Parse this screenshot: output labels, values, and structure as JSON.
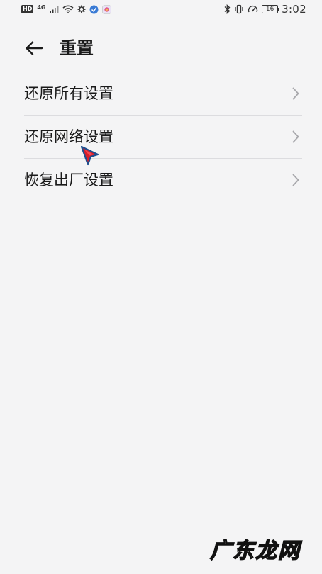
{
  "status_bar": {
    "left_icons": [
      "hd-badge",
      "4g-signal-icon",
      "signal-bars-icon",
      "wifi-icon",
      "settings-gear-icon",
      "app-notification-icon",
      "app-notification-icon-2"
    ],
    "hd_label": "HD",
    "network_label": "4G",
    "right_icons": [
      "bluetooth-icon",
      "vibrate-icon",
      "data-saver-icon",
      "battery-icon"
    ],
    "battery_level": "16",
    "time": "3:02"
  },
  "header": {
    "title": "重置"
  },
  "reset_options": [
    {
      "label": "还原所有设置"
    },
    {
      "label": "还原网络设置"
    },
    {
      "label": "恢复出厂设置"
    }
  ],
  "watermark": "广东龙网",
  "colors": {
    "background": "#f4f4f5",
    "text_primary": "#1a1a1a",
    "chevron": "#a8a8ac",
    "divider": "#dcdcdf",
    "cursor_red": "#d81e2a",
    "cursor_blue": "#1e4f8f"
  }
}
